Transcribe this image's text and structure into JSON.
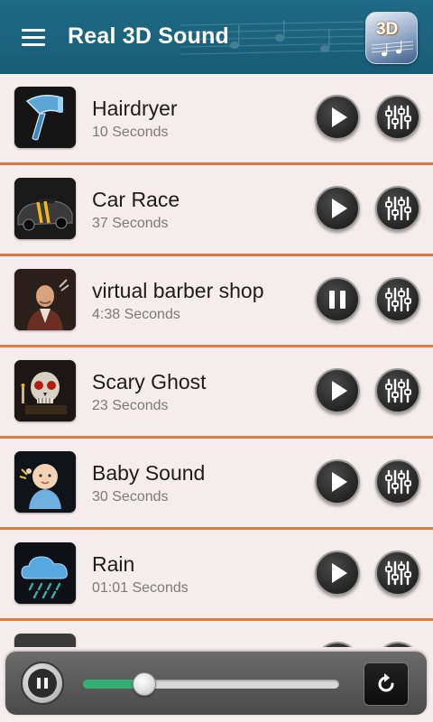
{
  "app": {
    "title": "Real 3D Sound",
    "logo_text": "3D",
    "colors": {
      "appbar": "#1f6a86",
      "divider": "#e07a3c",
      "progress": "#34b074",
      "list_background": "#f5eced"
    }
  },
  "sounds": [
    {
      "title": "Hairdryer",
      "duration": "10 Seconds",
      "thumbnail": "hairdryer-icon",
      "state": "stopped",
      "control_icon": "play-icon"
    },
    {
      "title": "Car Race",
      "duration": "37 Seconds",
      "thumbnail": "race-car-icon",
      "state": "stopped",
      "control_icon": "play-icon"
    },
    {
      "title": "virtual barber shop",
      "duration": "4:38 Seconds",
      "thumbnail": "barber-icon",
      "state": "playing",
      "control_icon": "pause-icon"
    },
    {
      "title": "Scary Ghost",
      "duration": "23 Seconds",
      "thumbnail": "skull-icon",
      "state": "stopped",
      "control_icon": "play-icon"
    },
    {
      "title": "Baby Sound",
      "duration": "30 Seconds",
      "thumbnail": "baby-icon",
      "state": "stopped",
      "control_icon": "play-icon"
    },
    {
      "title": "Rain",
      "duration": "01:01 Seconds",
      "thumbnail": "rain-cloud-icon",
      "state": "stopped",
      "control_icon": "play-icon"
    }
  ],
  "player": {
    "state": "playing",
    "control_icon": "pause-icon",
    "progress": 0.24,
    "repeat_icon": "repeat-icon"
  }
}
